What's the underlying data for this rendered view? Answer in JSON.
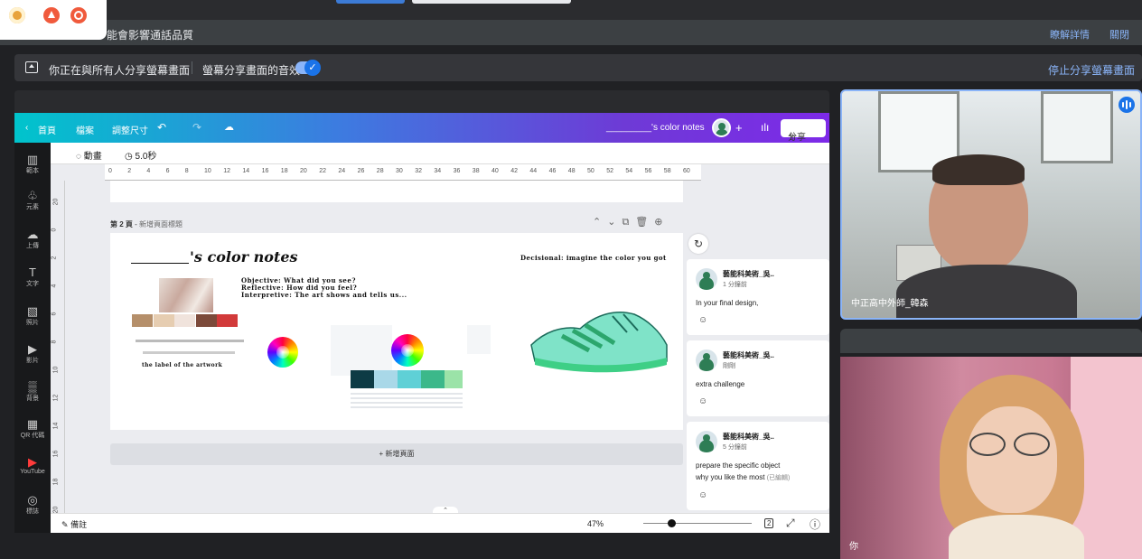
{
  "notice": {
    "message": "能會影響通話品質",
    "details_link": "瞭解詳情",
    "close_link": "關閉"
  },
  "share_bar": {
    "sharing_text": "你正在與所有人分享螢幕畫面",
    "audio_text": "螢幕分享畫面的音效",
    "audio_toggle_on": true,
    "stop_link": "停止分享螢幕畫面"
  },
  "canva": {
    "topbar": {
      "home": "首頁",
      "file": "檔案",
      "resize": "調整尺寸",
      "doc_title": "_________'s color notes",
      "share": "分享"
    },
    "sidebar": [
      {
        "label": "範本",
        "glyph": "▥"
      },
      {
        "label": "元素",
        "glyph": "♧"
      },
      {
        "label": "上傳",
        "glyph": "☁"
      },
      {
        "label": "文字",
        "glyph": "T"
      },
      {
        "label": "照片",
        "glyph": "▧"
      },
      {
        "label": "影片",
        "glyph": "▶"
      },
      {
        "label": "背景",
        "glyph": "▒"
      },
      {
        "label": "QR 代碼",
        "glyph": "▦"
      },
      {
        "label": "YouTube",
        "glyph": "▶"
      },
      {
        "label": "標誌",
        "glyph": "◎"
      }
    ],
    "toolbar": {
      "animate": "動畫",
      "duration": "5.0秒"
    },
    "ruler_h": [
      "0",
      "2",
      "4",
      "6",
      "8",
      "10",
      "12",
      "14",
      "16",
      "18",
      "20",
      "22",
      "24",
      "26",
      "28",
      "30",
      "32",
      "34",
      "36",
      "38",
      "40",
      "42",
      "44",
      "46",
      "48",
      "50",
      "52",
      "54",
      "56",
      "58",
      "60"
    ],
    "ruler_v": [
      "20",
      "0",
      "2",
      "4",
      "6",
      "8",
      "10",
      "12",
      "14",
      "16",
      "18",
      "20"
    ],
    "page": {
      "label": "第 2 頁",
      "title_placeholder": "新增頁面標題"
    },
    "slide": {
      "title": "'s color notes",
      "decisional": "Decisional:  imagine the color you got",
      "objective": "Objective: What did you see?",
      "reflective": "Reflective: How did you feel?",
      "interpretive": "Interpretive: The art shows and tells us...",
      "artwork_label": "the label of the artwork",
      "swatches": [
        "#b58f6a",
        "#e6cdb1",
        "#f0e3dc",
        "#7c4a3a",
        "#d23a3a"
      ]
    },
    "add_page": "+ 新增頁面",
    "bottom": {
      "notes": "備註",
      "zoom": "47%",
      "page_count": "2",
      "zoom_fraction": 0.47
    },
    "comments": [
      {
        "name": "藝能科美術_吳..",
        "time": "1 分鐘前",
        "text": "In your final design,"
      },
      {
        "name": "藝能科美術_吳..",
        "time": "剛剛",
        "text": "extra challenge"
      },
      {
        "name": "藝能科美術_吳..",
        "time": "5 分鐘前",
        "text": "prepare the specific object",
        "text2": "why you like the most",
        "edited": "(已編輯)"
      }
    ]
  },
  "video": {
    "tile1_name": "中正高中外師_韓森",
    "tile3_name": "你"
  }
}
